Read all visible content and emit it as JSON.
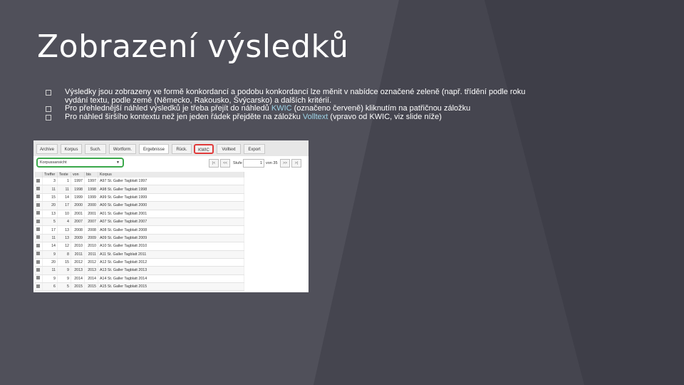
{
  "slide": {
    "title": "Zobrazení výsledků",
    "bullets": [
      {
        "parts": [
          "Výsledky jsou zobrazeny ve formě konkordancí a podobu konkordancí lze měnit v nabídce označené zeleně (např. třídění podle roku vydání textu, podle země (Německo, Rakousko, Švýcarsko) a dalších kritérií."
        ]
      },
      {
        "before": "Pro přehlednější náhled výsledků je třeba přejít do náhledů ",
        "link": "KWIC",
        "after": " (označeno červeně) kliknutím na patřičnou záložku"
      },
      {
        "before": "Pro náhled širšího kontextu než jen jeden řádek přejděte na záložku ",
        "link": "Volltext",
        "after": " (vpravo od KWIC, viz slide níže)"
      }
    ]
  },
  "screenshot": {
    "tabs": [
      "Archive",
      "Korpus",
      "Such.",
      "Wortform.",
      "Ergebnisse",
      "Rück.",
      "KWIC",
      "Volltext",
      "Export"
    ],
    "active_tab": "Ergebnisse",
    "highlight_tab": "KWIC",
    "view_select": "Korpussansicht",
    "pager": {
      "first": "|<",
      "prev": "<<",
      "label": "Stufe",
      "value": "1",
      "of": "von 35",
      "next": ">>",
      "last": ">|"
    },
    "columns": [
      "",
      "Treffer",
      "Texte",
      "von",
      "bis",
      "Korpus"
    ],
    "rows": [
      [
        "3",
        "1",
        "1997",
        "1997",
        "A97 St. Galler Tagblatt 1997"
      ],
      [
        "11",
        "11",
        "1998",
        "1998",
        "A98 St. Galler Tagblatt 1998"
      ],
      [
        "15",
        "14",
        "1999",
        "1999",
        "A99 St. Galler Tagblatt 1999"
      ],
      [
        "20",
        "17",
        "2000",
        "2000",
        "A00 St. Galler Tagblatt 2000"
      ],
      [
        "13",
        "10",
        "2001",
        "2001",
        "A01 St. Galler Tagblatt 2001"
      ],
      [
        "5",
        "4",
        "2007",
        "2007",
        "A07 St. Galler Tagblatt 2007"
      ],
      [
        "17",
        "13",
        "2008",
        "2008",
        "A08 St. Galler Tagblatt 2008"
      ],
      [
        "11",
        "13",
        "2009",
        "2009",
        "A09 St. Galler Tagblatt 2009"
      ],
      [
        "14",
        "12",
        "2010",
        "2010",
        "A10 St. Galler Tagblatt 2010"
      ],
      [
        "9",
        "8",
        "2011",
        "2011",
        "A11 St. Galler Tagblatt 2011"
      ],
      [
        "20",
        "15",
        "2012",
        "2012",
        "A12 St. Galler Tagblatt 2012"
      ],
      [
        "11",
        "9",
        "2013",
        "2013",
        "A13 St. Galler Tagblatt 2013"
      ],
      [
        "9",
        "9",
        "2014",
        "2014",
        "A14 St. Galler Tagblatt 2014"
      ],
      [
        "6",
        "5",
        "2015",
        "2015",
        "A15 St. Galler Tagblatt 2015"
      ]
    ]
  },
  "colors": {
    "background": "#45454f",
    "accent_link": "#9fd5e8",
    "kwic_outline": "#e03a3a",
    "select_outline": "#3aa84a"
  }
}
